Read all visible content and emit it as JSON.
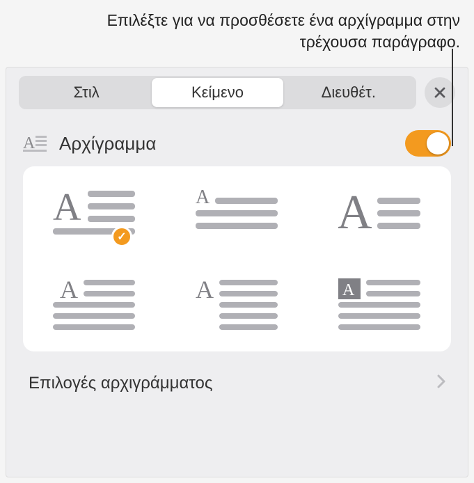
{
  "callout": {
    "text": "Επιλέξτε για να προσθέσετε ένα αρχίγραμμα στην τρέχουσα παράγραφο."
  },
  "tabs": {
    "items": [
      {
        "label": "Στιλ",
        "active": false
      },
      {
        "label": "Κείμενο",
        "active": true
      },
      {
        "label": "Διευθέτ.",
        "active": false
      }
    ]
  },
  "section": {
    "title": "Αρχίγραμμα",
    "toggle_on": true
  },
  "dropcap_styles": [
    {
      "name": "dropcap-large-left",
      "selected": true
    },
    {
      "name": "dropcap-small-raised",
      "selected": false
    },
    {
      "name": "dropcap-serif-tall",
      "selected": false
    },
    {
      "name": "dropcap-indent-left",
      "selected": false
    },
    {
      "name": "dropcap-margin",
      "selected": false
    },
    {
      "name": "dropcap-boxed",
      "selected": false
    }
  ],
  "options_row": {
    "label": "Επιλογές αρχιγράμματος"
  },
  "colors": {
    "accent": "#f39a1f"
  }
}
